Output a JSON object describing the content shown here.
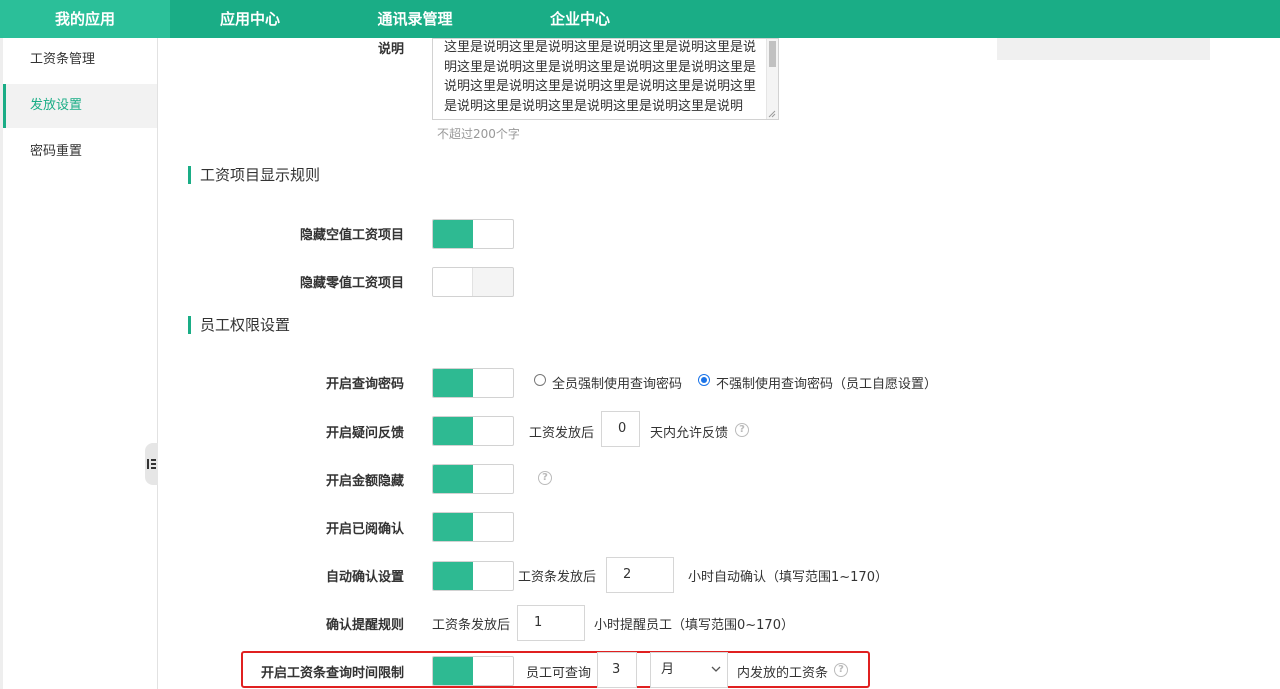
{
  "topnav": {
    "items": [
      {
        "label": "我的应用"
      },
      {
        "label": "应用中心"
      },
      {
        "label": "通讯录管理"
      },
      {
        "label": "企业中心"
      }
    ]
  },
  "sidebar": {
    "items": [
      {
        "label": "工资条管理"
      },
      {
        "label": "发放设置"
      },
      {
        "label": "密码重置"
      }
    ]
  },
  "description": {
    "label": "说明",
    "text": "这里是说明这里是说明这里是说明这里是说明这里是说明这里是说明这里是说明这里是说明这里是说明这里是说明这里是说明这里是说明这里是说明这里是说明这里是说明这里是说明这里是说明这里是说明这里是说明",
    "hint": "不超过200个字"
  },
  "display_rules": {
    "title": "工资项目显示规则",
    "hide_empty": {
      "label": "隐藏空值工资项目",
      "on": true
    },
    "hide_zero": {
      "label": "隐藏零值工资项目",
      "on": false
    }
  },
  "permissions": {
    "title": "员工权限设置",
    "query_password": {
      "label": "开启查询密码",
      "on": true,
      "option_forced": "全员强制使用查询密码",
      "option_optional": "不强制使用查询密码（员工自愿设置）",
      "selected": "optional"
    },
    "feedback": {
      "label": "开启疑问反馈",
      "on": true,
      "prefix": "工资发放后",
      "days": "0",
      "suffix": "天内允许反馈"
    },
    "amount_hidden": {
      "label": "开启金额隐藏",
      "on": true
    },
    "read_confirm": {
      "label": "开启已阅确认",
      "on": true
    },
    "auto_confirm": {
      "label": "自动确认设置",
      "on": true,
      "prefix": "工资条发放后",
      "hours": "2",
      "suffix": "小时自动确认（填写范围1~170）"
    },
    "confirm_reminder": {
      "label": "确认提醒规则",
      "prefix": "工资条发放后",
      "hours": "1",
      "suffix": "小时提醒员工（填写范围0~170）"
    },
    "query_time_limit": {
      "label": "开启工资条查询时间限制",
      "on": true,
      "prefix": "员工可查询",
      "count": "3",
      "unit": "月",
      "suffix": "内发放的工资条"
    }
  },
  "colors": {
    "accent": "#1aad86",
    "highlight_border": "#e02020"
  },
  "icons": {
    "help": "question-circle-icon",
    "collapse": "collapse-sidebar-icon"
  }
}
